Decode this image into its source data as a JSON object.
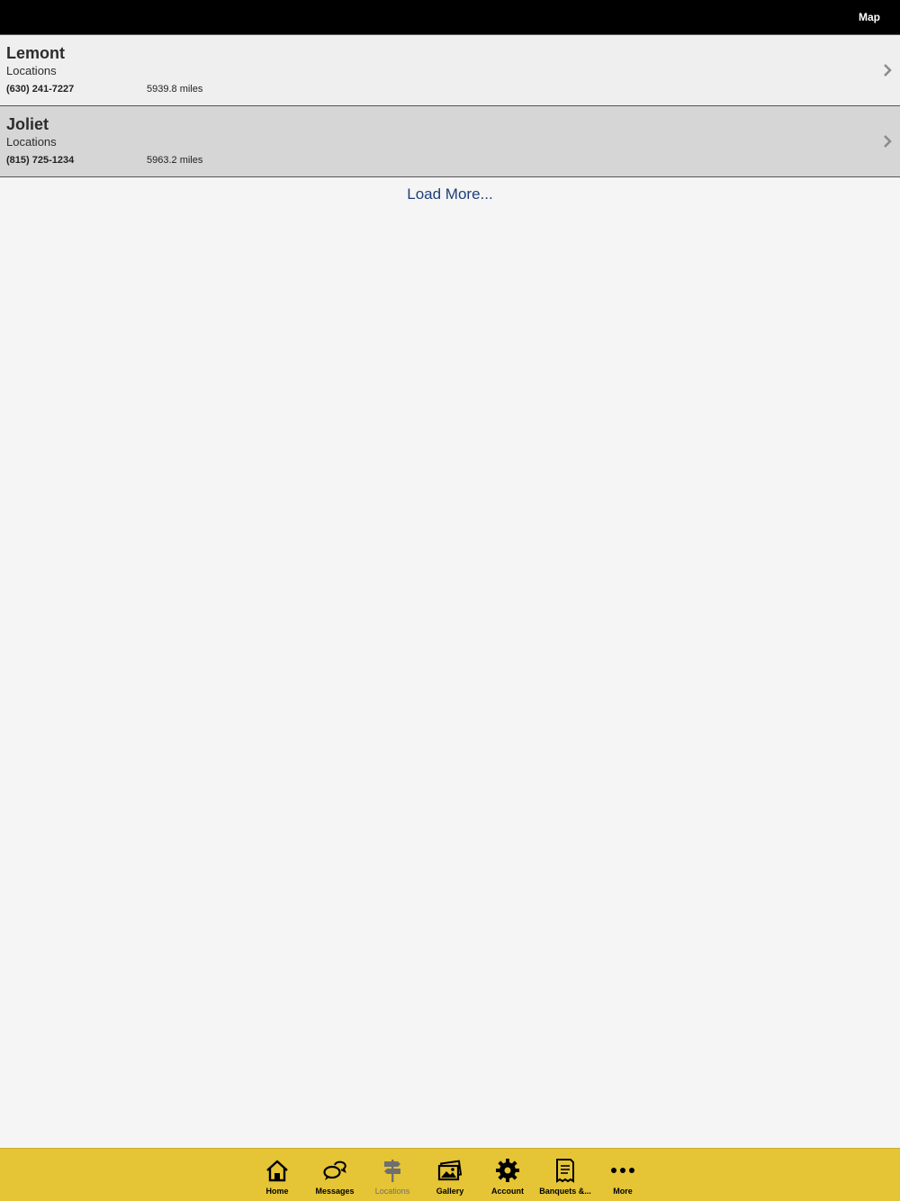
{
  "header": {
    "map_label": "Map"
  },
  "locations": [
    {
      "name": "Lemont",
      "category": "Locations",
      "phone": "(630) 241-7227",
      "distance": "5939.8 miles"
    },
    {
      "name": "Joliet",
      "category": "Locations",
      "phone": "(815) 725-1234",
      "distance": "5963.2 miles"
    }
  ],
  "load_more": "Load More...",
  "tabbar": {
    "tabs": [
      {
        "label": "Home",
        "icon": "home-icon"
      },
      {
        "label": "Messages",
        "icon": "messages-icon"
      },
      {
        "label": "Locations",
        "icon": "signpost-icon",
        "active": true
      },
      {
        "label": "Gallery",
        "icon": "gallery-icon"
      },
      {
        "label": "Account",
        "icon": "gear-icon"
      },
      {
        "label": "Banquets &...",
        "icon": "receipt-icon"
      },
      {
        "label": "More",
        "icon": "more-icon"
      }
    ]
  },
  "colors": {
    "tabbar_bg": "#e5c436",
    "topbar_bg": "#000000",
    "link": "#1e3f78"
  }
}
